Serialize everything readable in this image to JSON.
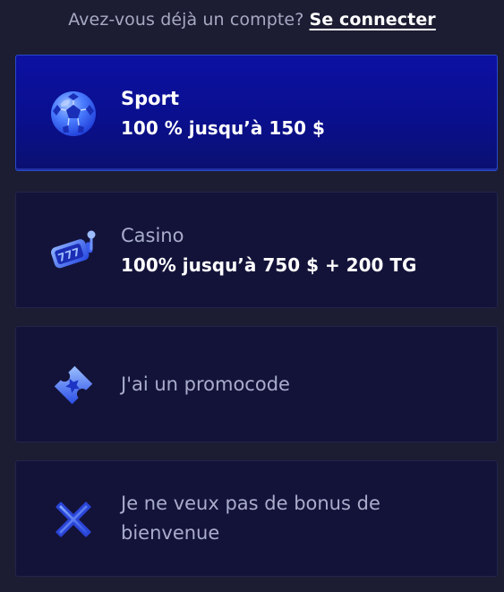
{
  "login": {
    "prompt": "Avez-vous déjà un compte?",
    "link": "Se connecter"
  },
  "options": [
    {
      "title": "Sport",
      "subtitle": "100 % jusqu’à 150 $",
      "icon": "soccer-ball-icon",
      "selected": true
    },
    {
      "title": "Casino",
      "subtitle": "100% jusqu’à 750 $ + 200 TG",
      "icon": "slot-machine-icon",
      "selected": false
    },
    {
      "title": "J'ai un promocode",
      "icon": "ticket-icon",
      "selected": false
    },
    {
      "title": "Je ne veux pas de bonus de bienvenue",
      "icon": "cross-icon",
      "selected": false
    }
  ],
  "colors": {
    "background": "#1c1c33",
    "card": "#13133a",
    "selected_card": "#0c11a2",
    "icon_blue": "#3d6cff"
  }
}
